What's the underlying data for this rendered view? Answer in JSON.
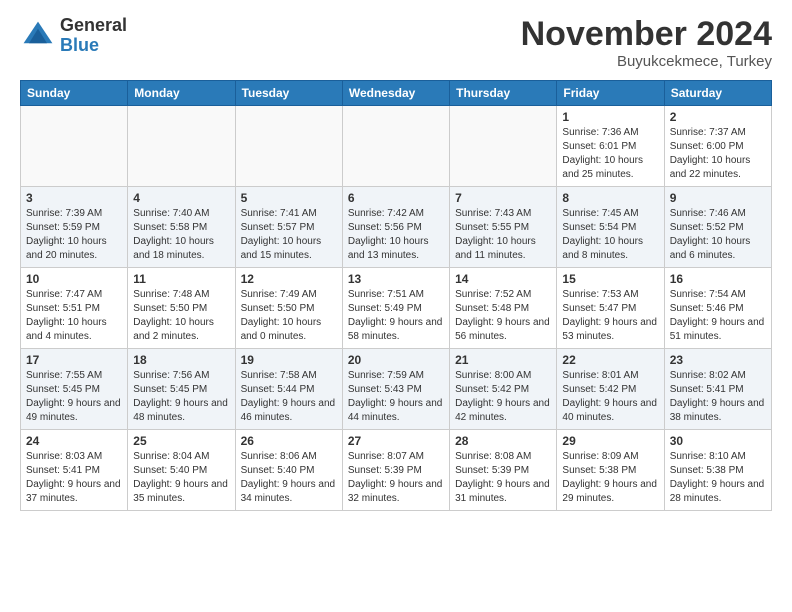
{
  "logo": {
    "general": "General",
    "blue": "Blue"
  },
  "header": {
    "month": "November 2024",
    "location": "Buyukcekmece, Turkey"
  },
  "weekdays": [
    "Sunday",
    "Monday",
    "Tuesday",
    "Wednesday",
    "Thursday",
    "Friday",
    "Saturday"
  ],
  "weeks": [
    [
      {
        "day": "",
        "sunrise": "",
        "sunset": "",
        "daylight": ""
      },
      {
        "day": "",
        "sunrise": "",
        "sunset": "",
        "daylight": ""
      },
      {
        "day": "",
        "sunrise": "",
        "sunset": "",
        "daylight": ""
      },
      {
        "day": "",
        "sunrise": "",
        "sunset": "",
        "daylight": ""
      },
      {
        "day": "",
        "sunrise": "",
        "sunset": "",
        "daylight": ""
      },
      {
        "day": "1",
        "sunrise": "Sunrise: 7:36 AM",
        "sunset": "Sunset: 6:01 PM",
        "daylight": "Daylight: 10 hours and 25 minutes."
      },
      {
        "day": "2",
        "sunrise": "Sunrise: 7:37 AM",
        "sunset": "Sunset: 6:00 PM",
        "daylight": "Daylight: 10 hours and 22 minutes."
      }
    ],
    [
      {
        "day": "3",
        "sunrise": "Sunrise: 7:39 AM",
        "sunset": "Sunset: 5:59 PM",
        "daylight": "Daylight: 10 hours and 20 minutes."
      },
      {
        "day": "4",
        "sunrise": "Sunrise: 7:40 AM",
        "sunset": "Sunset: 5:58 PM",
        "daylight": "Daylight: 10 hours and 18 minutes."
      },
      {
        "day": "5",
        "sunrise": "Sunrise: 7:41 AM",
        "sunset": "Sunset: 5:57 PM",
        "daylight": "Daylight: 10 hours and 15 minutes."
      },
      {
        "day": "6",
        "sunrise": "Sunrise: 7:42 AM",
        "sunset": "Sunset: 5:56 PM",
        "daylight": "Daylight: 10 hours and 13 minutes."
      },
      {
        "day": "7",
        "sunrise": "Sunrise: 7:43 AM",
        "sunset": "Sunset: 5:55 PM",
        "daylight": "Daylight: 10 hours and 11 minutes."
      },
      {
        "day": "8",
        "sunrise": "Sunrise: 7:45 AM",
        "sunset": "Sunset: 5:54 PM",
        "daylight": "Daylight: 10 hours and 8 minutes."
      },
      {
        "day": "9",
        "sunrise": "Sunrise: 7:46 AM",
        "sunset": "Sunset: 5:52 PM",
        "daylight": "Daylight: 10 hours and 6 minutes."
      }
    ],
    [
      {
        "day": "10",
        "sunrise": "Sunrise: 7:47 AM",
        "sunset": "Sunset: 5:51 PM",
        "daylight": "Daylight: 10 hours and 4 minutes."
      },
      {
        "day": "11",
        "sunrise": "Sunrise: 7:48 AM",
        "sunset": "Sunset: 5:50 PM",
        "daylight": "Daylight: 10 hours and 2 minutes."
      },
      {
        "day": "12",
        "sunrise": "Sunrise: 7:49 AM",
        "sunset": "Sunset: 5:50 PM",
        "daylight": "Daylight: 10 hours and 0 minutes."
      },
      {
        "day": "13",
        "sunrise": "Sunrise: 7:51 AM",
        "sunset": "Sunset: 5:49 PM",
        "daylight": "Daylight: 9 hours and 58 minutes."
      },
      {
        "day": "14",
        "sunrise": "Sunrise: 7:52 AM",
        "sunset": "Sunset: 5:48 PM",
        "daylight": "Daylight: 9 hours and 56 minutes."
      },
      {
        "day": "15",
        "sunrise": "Sunrise: 7:53 AM",
        "sunset": "Sunset: 5:47 PM",
        "daylight": "Daylight: 9 hours and 53 minutes."
      },
      {
        "day": "16",
        "sunrise": "Sunrise: 7:54 AM",
        "sunset": "Sunset: 5:46 PM",
        "daylight": "Daylight: 9 hours and 51 minutes."
      }
    ],
    [
      {
        "day": "17",
        "sunrise": "Sunrise: 7:55 AM",
        "sunset": "Sunset: 5:45 PM",
        "daylight": "Daylight: 9 hours and 49 minutes."
      },
      {
        "day": "18",
        "sunrise": "Sunrise: 7:56 AM",
        "sunset": "Sunset: 5:45 PM",
        "daylight": "Daylight: 9 hours and 48 minutes."
      },
      {
        "day": "19",
        "sunrise": "Sunrise: 7:58 AM",
        "sunset": "Sunset: 5:44 PM",
        "daylight": "Daylight: 9 hours and 46 minutes."
      },
      {
        "day": "20",
        "sunrise": "Sunrise: 7:59 AM",
        "sunset": "Sunset: 5:43 PM",
        "daylight": "Daylight: 9 hours and 44 minutes."
      },
      {
        "day": "21",
        "sunrise": "Sunrise: 8:00 AM",
        "sunset": "Sunset: 5:42 PM",
        "daylight": "Daylight: 9 hours and 42 minutes."
      },
      {
        "day": "22",
        "sunrise": "Sunrise: 8:01 AM",
        "sunset": "Sunset: 5:42 PM",
        "daylight": "Daylight: 9 hours and 40 minutes."
      },
      {
        "day": "23",
        "sunrise": "Sunrise: 8:02 AM",
        "sunset": "Sunset: 5:41 PM",
        "daylight": "Daylight: 9 hours and 38 minutes."
      }
    ],
    [
      {
        "day": "24",
        "sunrise": "Sunrise: 8:03 AM",
        "sunset": "Sunset: 5:41 PM",
        "daylight": "Daylight: 9 hours and 37 minutes."
      },
      {
        "day": "25",
        "sunrise": "Sunrise: 8:04 AM",
        "sunset": "Sunset: 5:40 PM",
        "daylight": "Daylight: 9 hours and 35 minutes."
      },
      {
        "day": "26",
        "sunrise": "Sunrise: 8:06 AM",
        "sunset": "Sunset: 5:40 PM",
        "daylight": "Daylight: 9 hours and 34 minutes."
      },
      {
        "day": "27",
        "sunrise": "Sunrise: 8:07 AM",
        "sunset": "Sunset: 5:39 PM",
        "daylight": "Daylight: 9 hours and 32 minutes."
      },
      {
        "day": "28",
        "sunrise": "Sunrise: 8:08 AM",
        "sunset": "Sunset: 5:39 PM",
        "daylight": "Daylight: 9 hours and 31 minutes."
      },
      {
        "day": "29",
        "sunrise": "Sunrise: 8:09 AM",
        "sunset": "Sunset: 5:38 PM",
        "daylight": "Daylight: 9 hours and 29 minutes."
      },
      {
        "day": "30",
        "sunrise": "Sunrise: 8:10 AM",
        "sunset": "Sunset: 5:38 PM",
        "daylight": "Daylight: 9 hours and 28 minutes."
      }
    ]
  ]
}
